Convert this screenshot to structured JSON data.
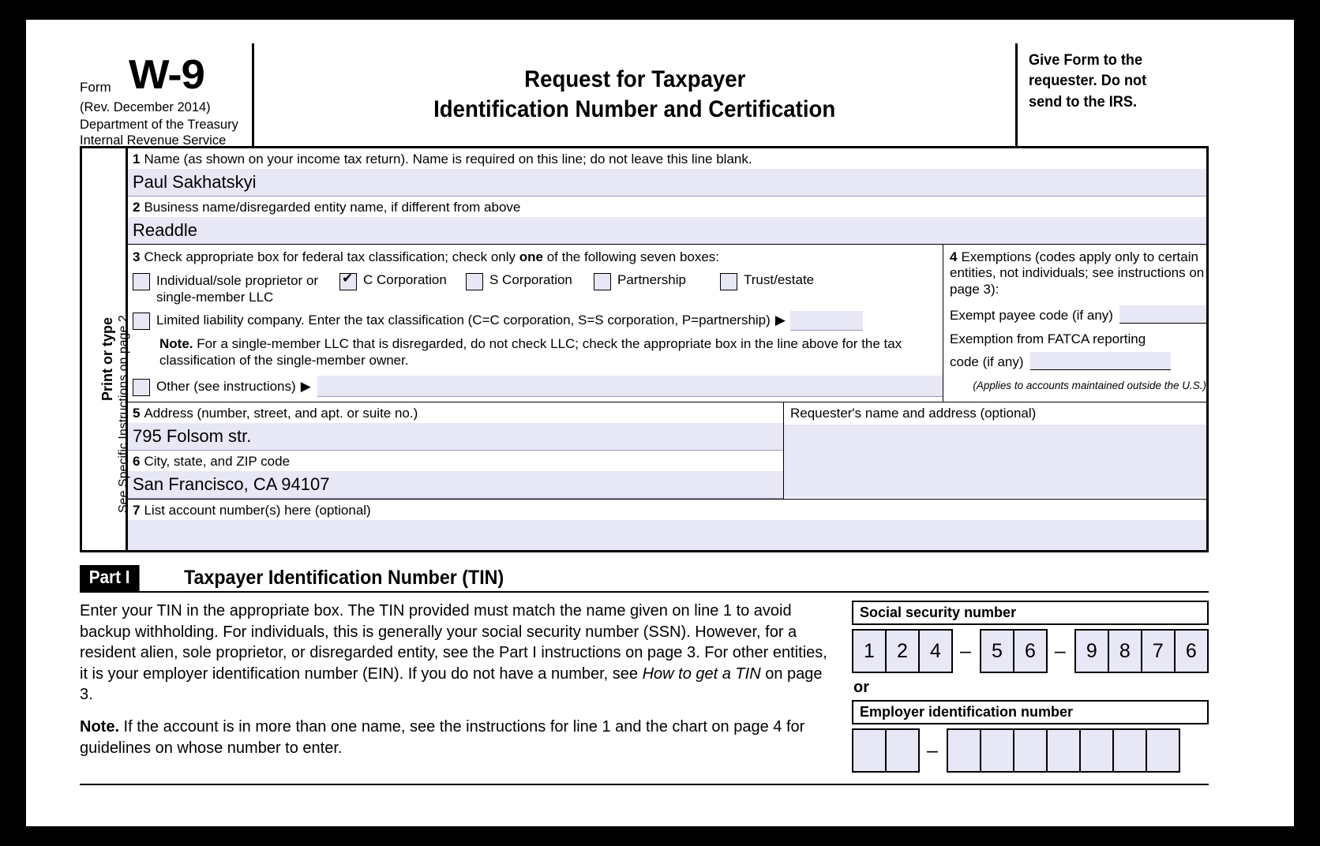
{
  "header": {
    "form_label": "Form",
    "form_number": "W-9",
    "revision": "(Rev. December 2014)",
    "dept_line1": "Department of the Treasury",
    "dept_line2": "Internal Revenue Service",
    "title_line1": "Request for Taxpayer",
    "title_line2": "Identification Number and Certification",
    "notice_line1": "Give Form to the",
    "notice_line2": "requester. Do not",
    "notice_line3": "send to the IRS."
  },
  "rail": {
    "bold_text": "Print or type",
    "text": "See Specific Instructions on page 2."
  },
  "line1": {
    "number": "1",
    "label": "Name (as shown on your income tax return). Name is required on this line; do not leave this line blank.",
    "value": "Paul Sakhatskyi"
  },
  "line2": {
    "number": "2",
    "label": "Business name/disregarded entity name, if different from above",
    "value": "Readdle"
  },
  "line3": {
    "number": "3",
    "label_pre": "Check appropriate box for federal tax classification; check only ",
    "label_bold": "one",
    "label_post": " of the following seven boxes:",
    "options": [
      {
        "label": "Individual/sole proprietor or single-member LLC",
        "checked": false
      },
      {
        "label": "C Corporation",
        "checked": true
      },
      {
        "label": "S Corporation",
        "checked": false
      },
      {
        "label": "Partnership",
        "checked": false
      },
      {
        "label": "Trust/estate",
        "checked": false
      }
    ],
    "llc_label": "Limited liability company. Enter the tax classification (C=C corporation, S=S corporation, P=partnership)",
    "llc_arrow": "▶",
    "llc_value": "",
    "note_bold": "Note.",
    "note_text": " For a single-member LLC that is disregarded, do not check LLC; check the appropriate box in the line above for the tax classification of the single-member owner.",
    "other_label": "Other (see instructions)",
    "other_arrow": "▶",
    "other_value": ""
  },
  "line4": {
    "number": "4",
    "heading": "Exemptions (codes apply only to certain entities, not individuals; see instructions on page 3):",
    "exempt_payee_label": "Exempt payee code (if any)",
    "exempt_payee_value": "",
    "fatca_label_line1": "Exemption from FATCA reporting",
    "fatca_label_line2": "code (if any)",
    "fatca_value": "",
    "footnote": "(Applies to accounts maintained outside the U.S.)"
  },
  "line5": {
    "number": "5",
    "label": "Address (number, street, and apt. or suite no.)",
    "value": "795 Folsom str."
  },
  "line6": {
    "number": "6",
    "label": "City, state, and ZIP code",
    "value": "San Francisco, CA 94107"
  },
  "line7": {
    "number": "7",
    "label": "List account number(s) here (optional)",
    "value": ""
  },
  "requester": {
    "label": "Requester's name and address (optional)",
    "value": ""
  },
  "part1": {
    "badge": "Part I",
    "title": "Taxpayer Identification Number (TIN)",
    "paragraph1_a": "Enter your TIN in the appropriate box. The TIN provided must match the name given on line 1 to avoid backup withholding. For individuals, this is generally your social security number (SSN). However, for a resident alien, sole proprietor, or disregarded entity, see the Part I instructions on page 3. For other entities, it is your employer identification number (EIN). If you do not have a number, see ",
    "paragraph1_italic": "How to get a TIN",
    "paragraph1_b": " on page 3.",
    "note_bold": "Note.",
    "note_text": " If the account is in more than one name, see the instructions for line 1 and the chart on page 4 for guidelines on whose number to enter.",
    "ssn_label": "Social security number",
    "ssn_digits": [
      "1",
      "2",
      "4",
      "5",
      "6",
      "9",
      "8",
      "7",
      "6"
    ],
    "dash": "–",
    "or_label": "or",
    "ein_label": "Employer identification number",
    "ein_digits": [
      "",
      "",
      "",
      "",
      "",
      "",
      "",
      "",
      ""
    ]
  },
  "colors": {
    "field_fill": "#e7e7f6",
    "page_background": "#ffffff",
    "outer_background": "#000000"
  }
}
